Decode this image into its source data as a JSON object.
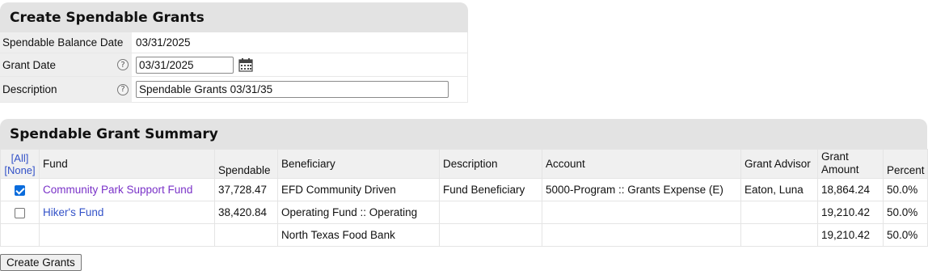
{
  "form": {
    "title": "Create Spendable Grants",
    "balance_date_label": "Spendable Balance Date",
    "balance_date_value": "03/31/2025",
    "grant_date_label": "Grant Date",
    "grant_date_value": "03/31/2025",
    "description_label": "Description",
    "description_value": "Spendable Grants 03/31/35",
    "help_glyph": "?",
    "calendar_icon": "calendar-icon"
  },
  "summary": {
    "title": "Spendable Grant Summary",
    "select_all": "[All]",
    "select_none": "[None]",
    "headers": {
      "fund": "Fund",
      "spendable": "Spendable",
      "beneficiary": "Beneficiary",
      "description": "Description",
      "account": "Account",
      "advisor": "Grant Advisor",
      "amount_line1": "Grant",
      "amount_line2": "Amount",
      "percent": "Percent"
    },
    "rows": [
      {
        "checked": true,
        "fund": "Community Park Support Fund",
        "spendable": "37,728.47",
        "beneficiary": "EFD Community Driven",
        "description": "Fund Beneficiary",
        "account": "5000-Program :: Grants Expense (E)",
        "advisor": "Eaton, Luna",
        "amount": "18,864.24",
        "percent": "50.0%"
      },
      {
        "checked": false,
        "fund": "Hiker's Fund",
        "spendable": "38,420.84",
        "beneficiary": "Operating Fund :: Operating",
        "description": "",
        "account": "",
        "advisor": "",
        "amount": "19,210.42",
        "percent": "50.0%"
      },
      {
        "beneficiary": "North Texas Food Bank",
        "amount": "19,210.42",
        "percent": "50.0%"
      }
    ]
  },
  "actions": {
    "create_label": "Create Grants"
  }
}
